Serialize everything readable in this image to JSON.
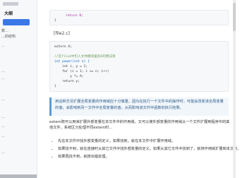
{
  "sidebar": {
    "title": "大纲",
    "items": [
      "数…",
      "…的结构",
      "…",
      "…",
      "…",
      "…",
      "…",
      "…",
      "…",
      "…"
    ]
  },
  "code1": {
    "lines": [
      "return 0;",
      "}"
    ]
  },
  "label": "[file2.c]",
  "code2": {
    "line1": "extern A;",
    "comment": "//在file2中引入文件模块里的A的用法等",
    "lines": [
      "int power(int n) {",
      "    int i, y = 1;",
      "    for (i = 1; i <= n; i++)",
      "        y *= A;",
      "    return y;",
      "}"
    ]
  },
  "note": {
    "text": "用这种方法扩展全局变量的作用域应十分慎重，因为在执行一个文件中的操作时，可能会改变该全局变量的值，会影响到另一文件中全局变量的值，从而影响该文件中函数的执行结果。"
  },
  "para": "extern既可以用来扩展外部变量在本文件中的作用域，又可以使外部变量的作用域从一个文件扩展到程序中的其他文件，系统区分处理不同extern时…",
  "bullets": [
    "先在本文件中找外部变量的定义，如果找到，就在本文件中扩展作用域。",
    "如果找不到，就在连接时从其它文件中找外部变量的定义。如果从其它文件中找到了，就将作用域扩展到本文件。",
    "如果再找不到，就按出错处理。"
  ],
  "colors": {
    "accent": "#3b78e7",
    "note_border": "#5a9bd5"
  }
}
